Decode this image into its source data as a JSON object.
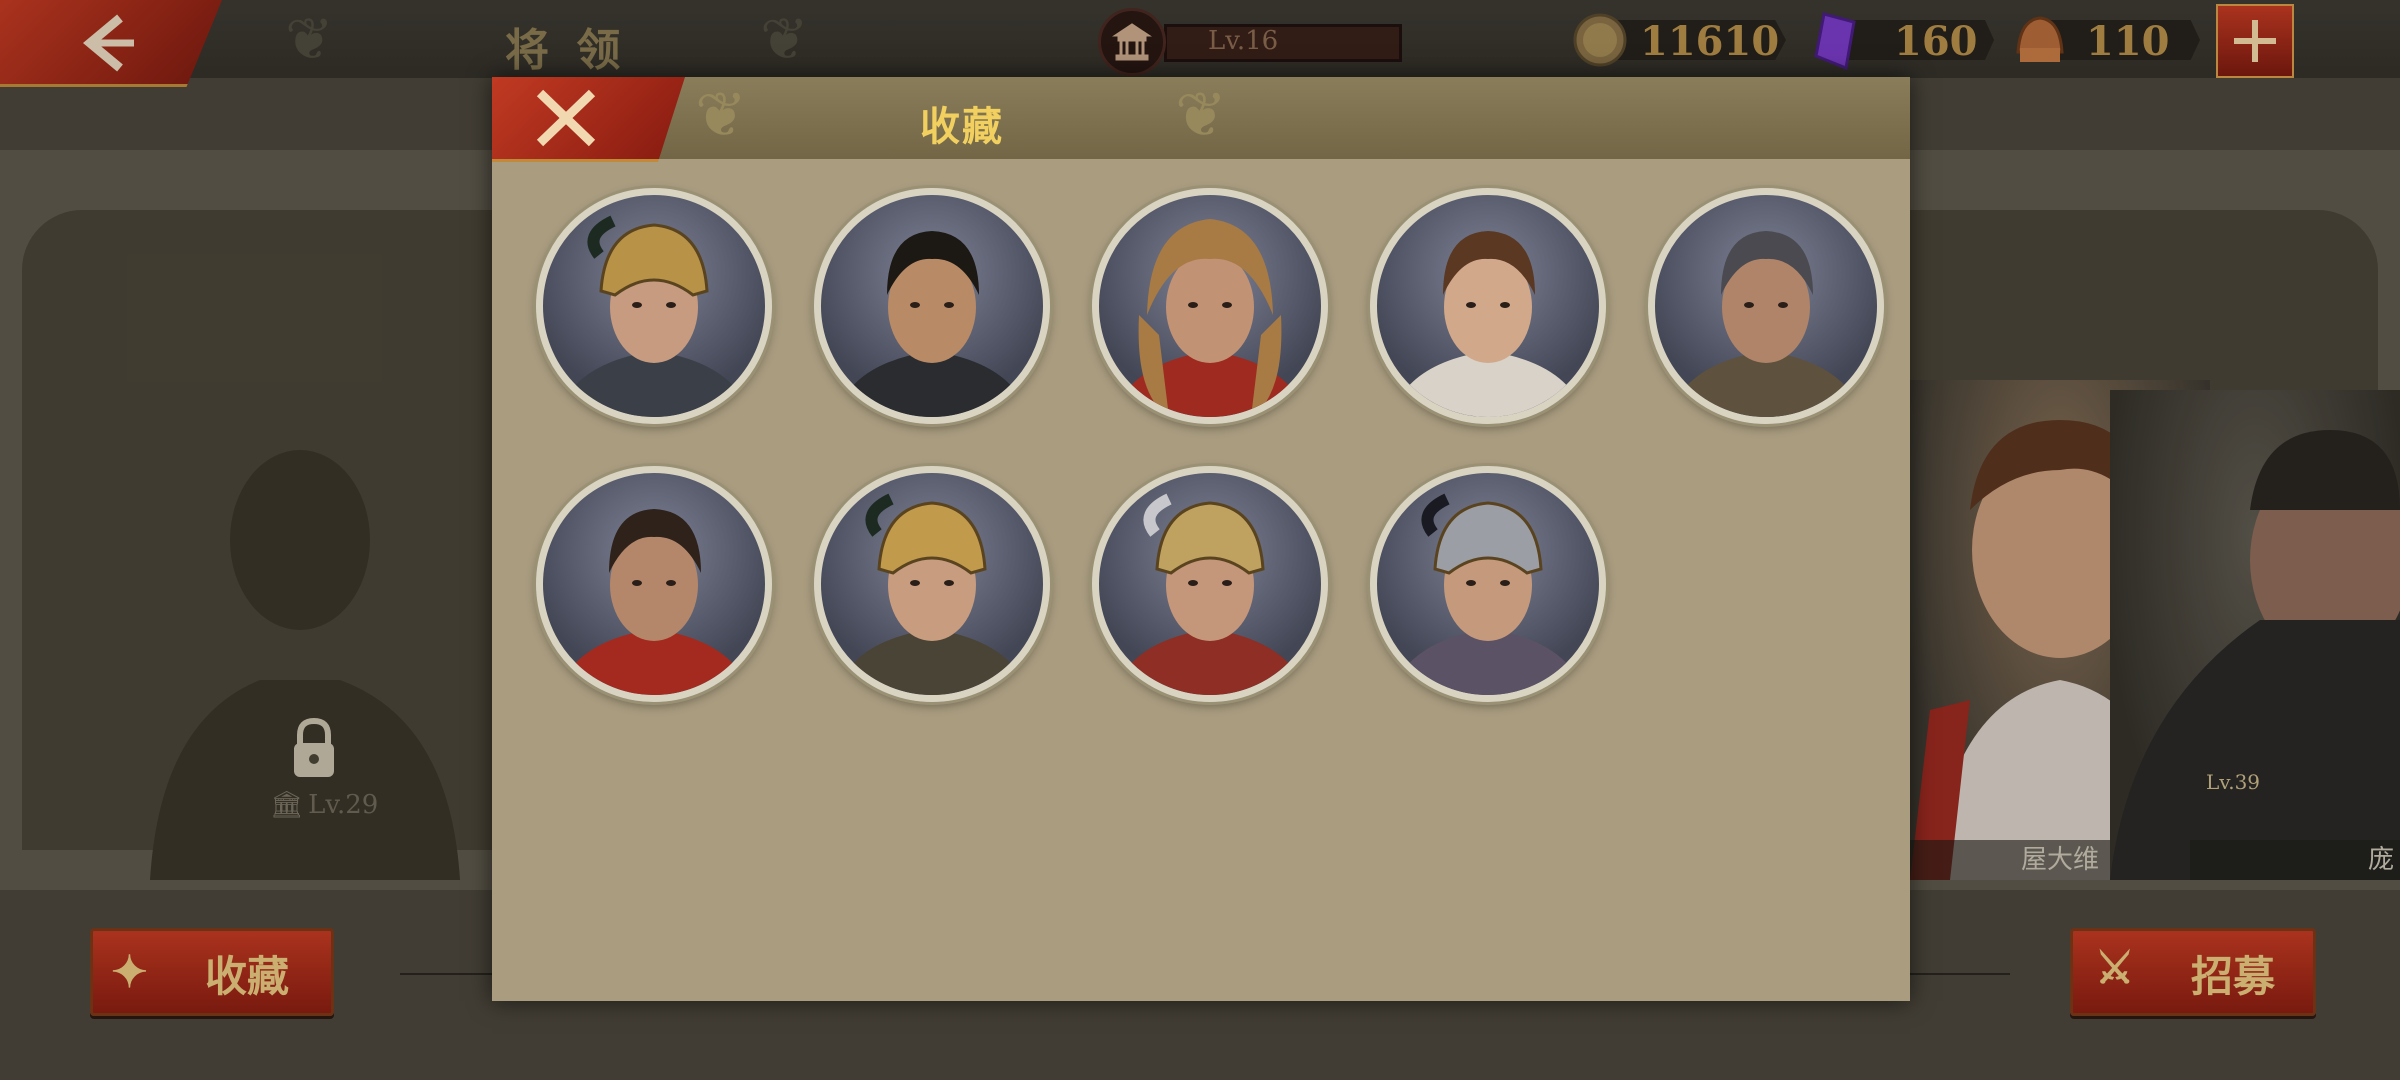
{
  "header": {
    "title": "将 领",
    "player_level": "Lv.16",
    "resources": [
      {
        "icon": "gold-coin-icon",
        "value": "11610"
      },
      {
        "icon": "purple-gem-icon",
        "value": "160"
      },
      {
        "icon": "spqr-helmet-icon",
        "value": "110"
      }
    ]
  },
  "background": {
    "locked_level": "Lv.29",
    "right_cards": [
      {
        "name": "屋大维",
        "level": ""
      },
      {
        "name": "庞",
        "level": "Lv.39"
      }
    ]
  },
  "buttons": {
    "collection": "收藏",
    "recruit": "招募"
  },
  "modal": {
    "title": "收藏",
    "heroes": [
      {
        "portrait": "gold-helmet-soldier"
      },
      {
        "portrait": "long-haired-warrior"
      },
      {
        "portrait": "lion-hood-warrior"
      },
      {
        "portrait": "young-man-white-toga"
      },
      {
        "portrait": "grey-haired-veteran"
      },
      {
        "portrait": "bearded-man-red-cloak"
      },
      {
        "portrait": "gold-helmet-officer"
      },
      {
        "portrait": "silver-gold-helmet-officer"
      },
      {
        "portrait": "silver-helmet-soldier"
      }
    ]
  },
  "colors": {
    "accent_red": "#c23a22",
    "gold_text": "#f2d060",
    "modal_bg": "#a99c7f"
  }
}
